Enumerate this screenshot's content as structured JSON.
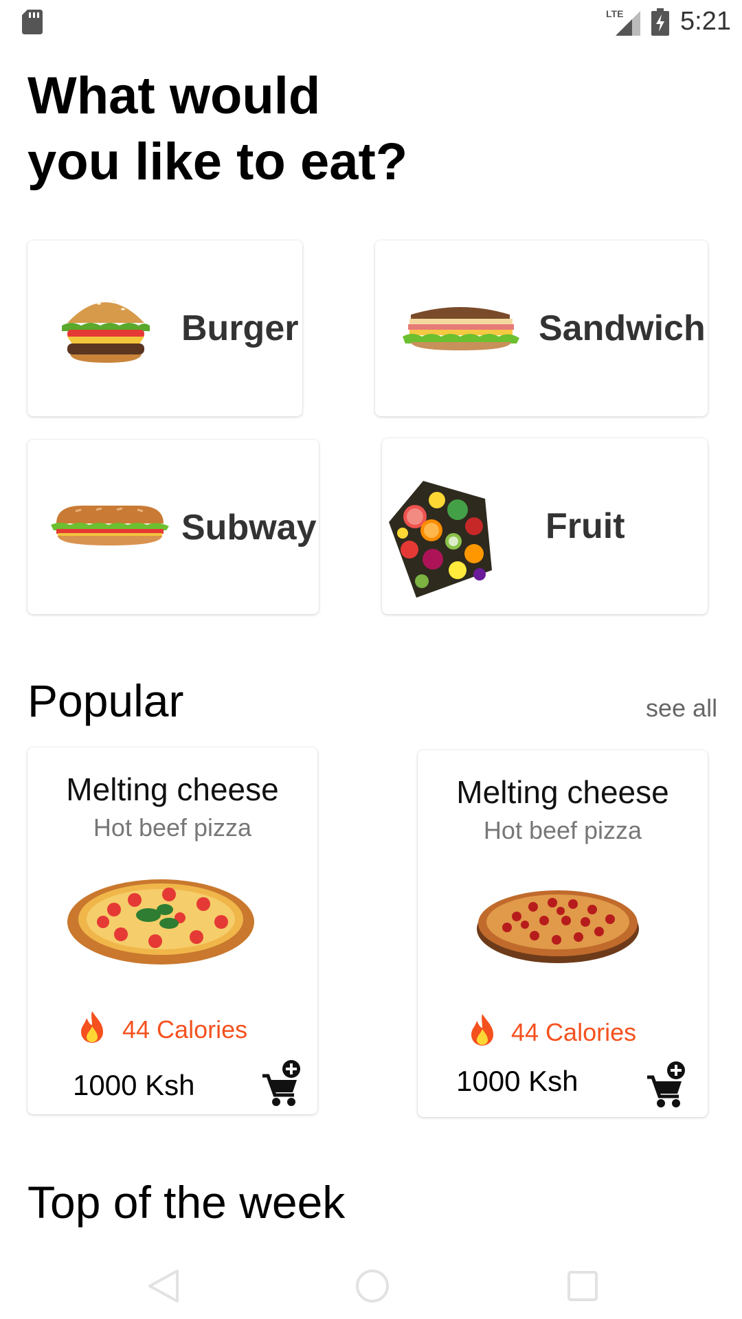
{
  "status_bar": {
    "network": "LTE",
    "time": "5:21",
    "icons": [
      "sd-card-icon",
      "lte-signal-icon",
      "battery-charging-icon"
    ]
  },
  "header": {
    "title_line1": "What would",
    "title_line2": "you like to eat?"
  },
  "categories": [
    {
      "label": "Burger",
      "icon": "burger-image"
    },
    {
      "label": "Sandwich",
      "icon": "sandwich-image"
    },
    {
      "label": "Subway",
      "icon": "subway-sandwich-image"
    },
    {
      "label": "Fruit",
      "icon": "fruit-image"
    }
  ],
  "popular": {
    "title": "Popular",
    "see_all": "see all",
    "items": [
      {
        "name": "Melting cheese",
        "subtitle": "Hot beef pizza",
        "calories": "44 Calories",
        "price": "1000 Ksh",
        "image": "margherita-pizza-image"
      },
      {
        "name": "Melting cheese",
        "subtitle": "Hot beef pizza",
        "calories": "44 Calories",
        "price": "1000 Ksh",
        "image": "pepperoni-pizza-image"
      }
    ]
  },
  "top_week": {
    "title": "Top of the week"
  },
  "nav_bar": {
    "buttons": [
      "back-icon",
      "home-icon",
      "recents-icon"
    ]
  },
  "colors": {
    "accent": "#f4511e",
    "text_dark": "#333333",
    "text_muted": "#777777",
    "background": "#ffffff"
  }
}
